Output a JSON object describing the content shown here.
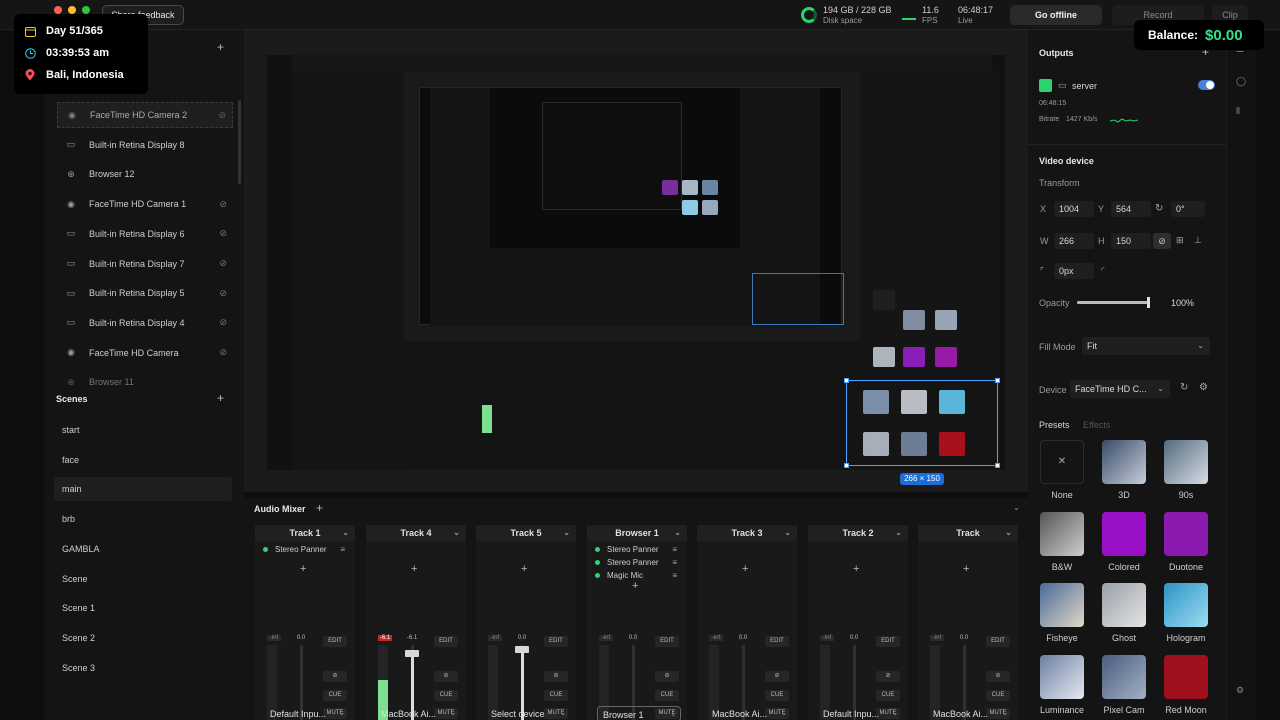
{
  "overlay": {
    "day": "Day 51/365",
    "time": "03:39:53 am",
    "location": "Bali, Indonesia"
  },
  "balance": {
    "label": "Balance:",
    "value": "$0.00"
  },
  "topbar": {
    "share_feedback": "Share feedback",
    "disk_value": "194 GB / 228 GB",
    "disk_label": "Disk space",
    "fps_value": "11.6",
    "fps_label": "FPS",
    "live_time": "06:48:17",
    "live_label": "Live",
    "go_offline": "Go offline",
    "record": "Record",
    "clip": "Clip"
  },
  "layers": {
    "items": [
      {
        "label": "FaceTime HD Camera 2",
        "icon": "camera-icon"
      },
      {
        "label": "Built-in Retina Display 8",
        "icon": "display-icon"
      },
      {
        "label": "Browser 12",
        "icon": "globe-icon"
      },
      {
        "label": "FaceTime HD Camera 1",
        "icon": "camera-icon"
      },
      {
        "label": "Built-in Retina Display 6",
        "icon": "display-icon"
      },
      {
        "label": "Built-in Retina Display 7",
        "icon": "display-icon"
      },
      {
        "label": "Built-in Retina Display 5",
        "icon": "display-icon"
      },
      {
        "label": "Built-in Retina Display 4",
        "icon": "display-icon"
      },
      {
        "label": "FaceTime HD Camera",
        "icon": "camera-icon"
      },
      {
        "label": "Browser 11",
        "icon": "globe-icon"
      }
    ]
  },
  "scenes": {
    "title": "Scenes",
    "items": [
      "start",
      "face",
      "main",
      "brb",
      "GAMBLA",
      "Scene",
      "Scene 1",
      "Scene 2",
      "Scene 3"
    ],
    "active": "main"
  },
  "preview": {
    "dimensions": "266 × 150"
  },
  "mixer": {
    "title": "Audio Mixer",
    "tracks": [
      {
        "name": "Track 1",
        "effects": [
          "Stereo Panner"
        ],
        "source": "Default Inpu...",
        "peak_l": "-inf",
        "peak_r": "0.0",
        "meter": 0,
        "fader": 0.0
      },
      {
        "name": "Track 4",
        "effects": [],
        "source": "MacBook Ai...",
        "peak_l": "-6.1",
        "peak_r": "-6.1",
        "meter": 0.55,
        "fader": 0.9
      },
      {
        "name": "Track 5",
        "effects": [],
        "source": "Select device",
        "peak_l": "-inf",
        "peak_r": "0.0",
        "meter": 0,
        "fader": 0.95
      },
      {
        "name": "Browser 1",
        "effects": [
          "Stereo Panner",
          "Stereo Panner",
          "Magic Mic"
        ],
        "source": "Browser 1",
        "peak_l": "-inf",
        "peak_r": "0.0",
        "meter": 0,
        "fader": 0.0
      },
      {
        "name": "Track 3",
        "effects": [],
        "source": "MacBook Ai...",
        "peak_l": "-inf",
        "peak_r": "0.0",
        "meter": 0,
        "fader": 0.0
      },
      {
        "name": "Track 2",
        "effects": [],
        "source": "Default Inpu...",
        "peak_l": "-inf",
        "peak_r": "0.0",
        "meter": 0,
        "fader": 0.0
      },
      {
        "name": "Track",
        "effects": [],
        "source": "MacBook Ai...",
        "peak_l": "-inf",
        "peak_r": "0.0",
        "meter": 0,
        "fader": 0.0
      }
    ],
    "buttons": {
      "edit": "EDIT",
      "cue": "CUE",
      "mute": "MUTE"
    }
  },
  "outputs": {
    "title": "Outputs",
    "name": "server",
    "time": "06:48:15",
    "bitrate_label": "Bitrate",
    "bitrate_value": "1427 Kb/s"
  },
  "video_device": {
    "title": "Video device",
    "transform_label": "Transform",
    "x_label": "X",
    "x": "1004",
    "y_label": "Y",
    "y": "564",
    "rotation": "0°",
    "w_label": "W",
    "w": "266",
    "h_label": "H",
    "h": "150",
    "corner": "0px",
    "opacity_label": "Opacity",
    "opacity": "100%",
    "opacity_level": 1.0,
    "fill_mode_label": "Fill Mode",
    "fill_mode": "Fit",
    "device_label": "Device",
    "device": "FaceTime HD C...",
    "tab_presets": "Presets",
    "tab_effects": "Effects",
    "presets": [
      {
        "label": "None"
      },
      {
        "label": "3D"
      },
      {
        "label": "90s"
      },
      {
        "label": "B&W"
      },
      {
        "label": "Colored"
      },
      {
        "label": "Duotone"
      },
      {
        "label": "Fisheye"
      },
      {
        "label": "Ghost"
      },
      {
        "label": "Hologram"
      },
      {
        "label": "Luminance"
      },
      {
        "label": "Pixel Cam"
      },
      {
        "label": "Red Moon"
      }
    ]
  },
  "colors": {
    "accent_green": "#2bd46c",
    "selection_blue": "#4ba3ff",
    "balance_green": "#2ee58a"
  }
}
